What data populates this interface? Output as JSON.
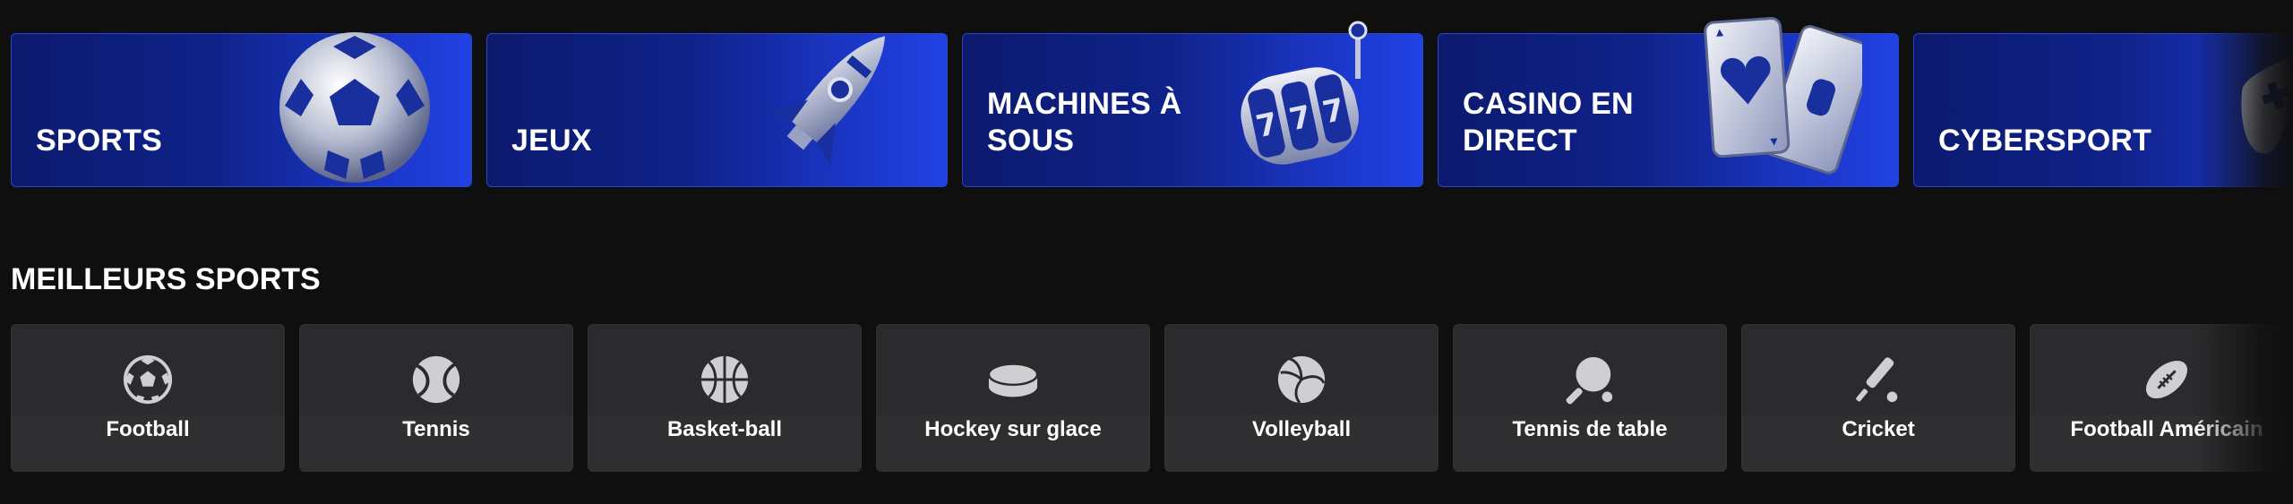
{
  "categories": [
    {
      "label": "SPORTS",
      "icon": "soccer-ball-icon"
    },
    {
      "label": "JEUX",
      "icon": "rocket-icon"
    },
    {
      "label": "MACHINES À SOUS",
      "icon": "slot-machine-777-icon"
    },
    {
      "label": "CASINO EN DIRECT",
      "icon": "playing-cards-icon"
    },
    {
      "label": "CYBERSPORT",
      "icon": "gamepad-icon"
    }
  ],
  "top_sports": {
    "title": "MEILLEURS SPORTS",
    "items": [
      {
        "label": "Football",
        "icon": "soccer-ball-icon"
      },
      {
        "label": "Tennis",
        "icon": "tennis-ball-icon"
      },
      {
        "label": "Basket-ball",
        "icon": "basketball-icon"
      },
      {
        "label": "Hockey sur glace",
        "icon": "hockey-puck-icon"
      },
      {
        "label": "Volleyball",
        "icon": "volleyball-icon"
      },
      {
        "label": "Tennis de table",
        "icon": "ping-pong-paddle-icon"
      },
      {
        "label": "Cricket",
        "icon": "cricket-bat-icon"
      },
      {
        "label": "Football Américain",
        "icon": "american-football-icon"
      }
    ]
  },
  "colors": {
    "background": "#0f0f10",
    "banner_dark": "#0c1a6e",
    "banner_bright": "#2142e3",
    "tile": "#2b2b2d",
    "icon": "#cfcfd2"
  }
}
